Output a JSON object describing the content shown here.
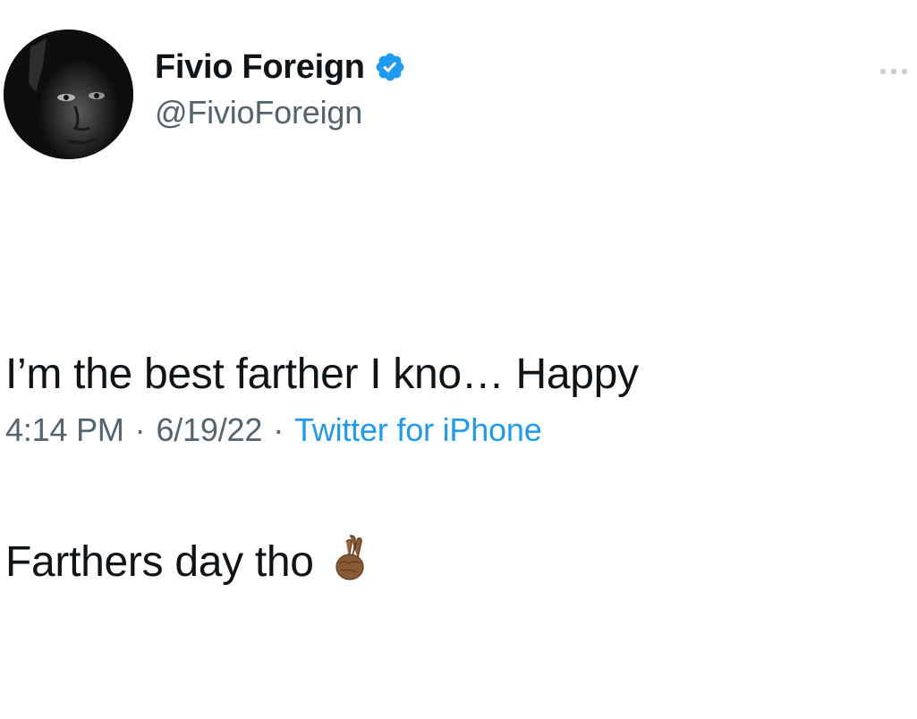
{
  "tweet": {
    "display_name": "Fivio Foreign",
    "handle": "@FivioForeign",
    "verified": true,
    "verified_icon": "verified-badge-icon",
    "more_icon": "more-options-icon",
    "avatar_icon": "profile-avatar",
    "text_line_1": "I’m the best farther I kno… Happy",
    "text_line_2": "Farthers day tho",
    "emoji_icon": "crossed-fingers-emoji",
    "time": "4:14 PM",
    "date": "6/19/22",
    "separator": "·",
    "source": "Twitter for iPhone"
  },
  "colors": {
    "text": "#0f1419",
    "secondary": "#536471",
    "link": "#1d9bf0",
    "verified": "#1d9bf0"
  }
}
